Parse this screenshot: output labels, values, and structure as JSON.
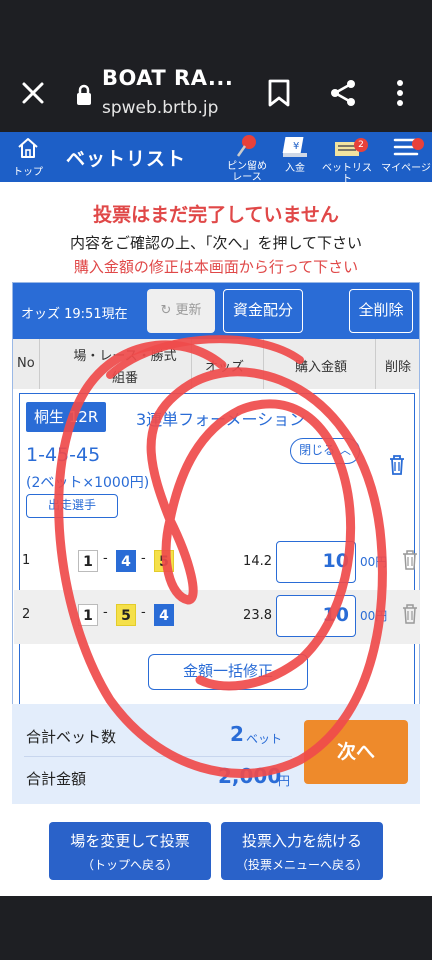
{
  "browser": {
    "title": "BOAT RA...",
    "domain": "spweb.brtb.jp"
  },
  "header": {
    "home_label": "トップ",
    "page_title": "ベットリスト",
    "nav": [
      {
        "label": "ピン留め\nレース"
      },
      {
        "label": "入金"
      },
      {
        "label": "ベットリスト",
        "badge": "2"
      },
      {
        "label": "マイページ"
      }
    ]
  },
  "notice": {
    "title": "投票はまだ完了していません",
    "line1": "内容をご確認の上、「次へ」を押して下さい",
    "line2": "購入金額の修正は本画面から行って下さい"
  },
  "odds_bar": {
    "label": "オッズ 19:51現在",
    "refresh": "更新",
    "allocate": "資金配分",
    "delete_all": "全削除"
  },
  "table_header": {
    "no": "No",
    "race": "場・レース・勝式",
    "combo": "組番",
    "odds": "オッズ",
    "amount": "購入金額",
    "delete": "削除"
  },
  "race": {
    "place": "桐生 12R",
    "type": "3連単フォーメーション",
    "combo": "1-45-45",
    "close": "閉じる",
    "bet_info": "(2ベット×1000円)",
    "racers": "出走選手",
    "bets": [
      {
        "no": "1",
        "boats": [
          "1",
          "4",
          "5"
        ],
        "odds": "14.2",
        "amount": "10",
        "unit": "00円"
      },
      {
        "no": "2",
        "boats": [
          "1",
          "5",
          "4"
        ],
        "odds": "23.8",
        "amount": "10",
        "unit": "00円"
      }
    ],
    "bulk_edit": "金額一括修正"
  },
  "summary": {
    "bet_count_label": "合計ベット数",
    "bet_count": "2",
    "bet_unit": "ベット",
    "total_label": "合計金額",
    "total": "2,000",
    "total_unit": "円",
    "next": "次へ"
  },
  "footer": {
    "change_venue": "場を変更して投票",
    "change_venue_sub": "（トップへ戻る）",
    "continue": "投票入力を続ける",
    "continue_sub": "（投票メニューへ戻る）"
  },
  "colors": {
    "brand_blue": "#1d5fc7",
    "warning_red": "#e04848",
    "next_orange": "#ee8a2b",
    "annotation_red": "#ef4b4b"
  }
}
